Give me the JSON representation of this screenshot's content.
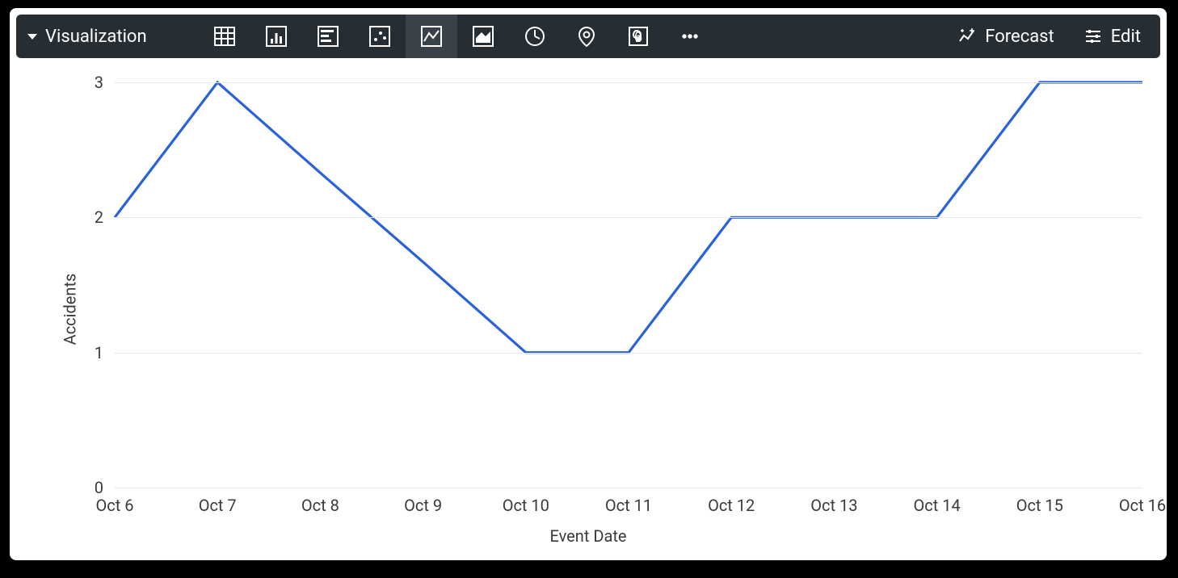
{
  "toolbar": {
    "title": "Visualization",
    "forecast_label": "Forecast",
    "edit_label": "Edit"
  },
  "chart_data": {
    "type": "line",
    "categories": [
      "Oct 6",
      "Oct 7",
      "Oct 8",
      "Oct 9",
      "Oct 10",
      "Oct 11",
      "Oct 12",
      "Oct 13",
      "Oct 14",
      "Oct 15",
      "Oct 16"
    ],
    "values": [
      2,
      3,
      2.33,
      1.67,
      1,
      1,
      2,
      2,
      2,
      3,
      3
    ],
    "xlabel": "Event Date",
    "ylabel": "Accidents",
    "ylim": [
      0,
      3
    ],
    "yticks": [
      0,
      1,
      2,
      3
    ]
  }
}
